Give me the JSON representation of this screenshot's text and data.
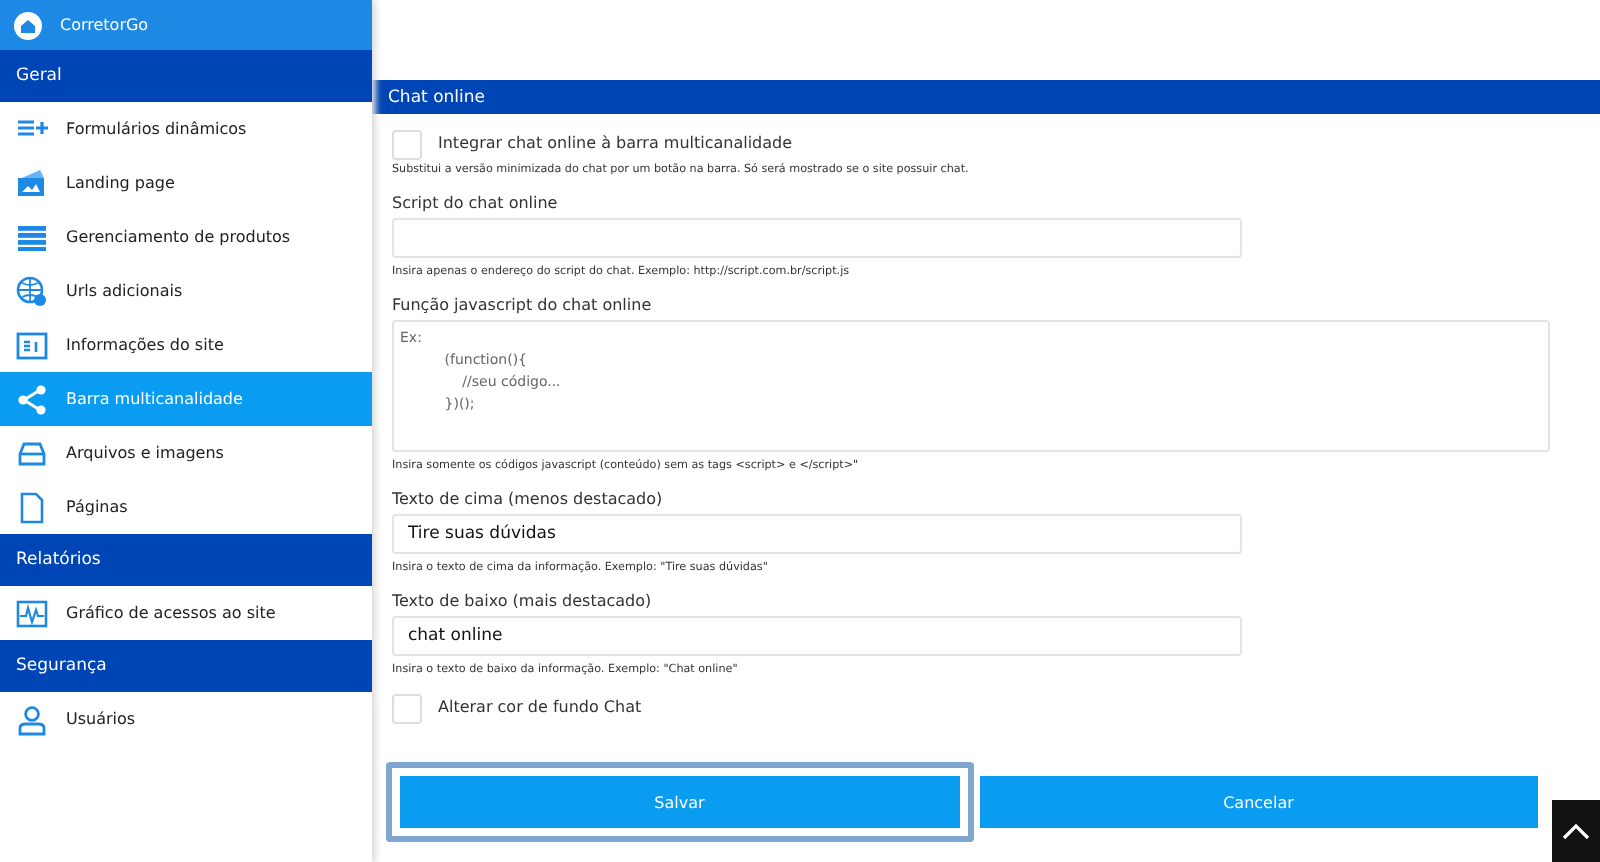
{
  "brand": {
    "title": "CorretorGo"
  },
  "sidebar": {
    "sections": [
      {
        "title": "Geral",
        "items": [
          {
            "label": "Formulários dinâmicos",
            "selected": false
          },
          {
            "label": "Landing page",
            "selected": false
          },
          {
            "label": "Gerenciamento de produtos",
            "selected": false
          },
          {
            "label": "Urls adicionais",
            "selected": false
          },
          {
            "label": "Informações do site",
            "selected": false
          },
          {
            "label": "Barra multicanalidade",
            "selected": true
          },
          {
            "label": "Arquivos e imagens",
            "selected": false
          },
          {
            "label": "Páginas",
            "selected": false
          }
        ]
      },
      {
        "title": "Relatórios",
        "items": [
          {
            "label": "Gráfico de acessos ao site",
            "selected": false
          }
        ]
      },
      {
        "title": "Segurança",
        "items": [
          {
            "label": "Usuários",
            "selected": false
          }
        ]
      }
    ]
  },
  "panel": {
    "title": "Chat online",
    "fields": [
      {
        "kind": "checkbox",
        "label": "Integrar chat online à barra multicanalidade",
        "checked": false,
        "help": "Substitui a versão minimizada do chat por um botão na barra. Só será mostrado se o site possuir chat."
      },
      {
        "kind": "text",
        "label": "Script do chat online",
        "help": "Insira apenas o endereço do script do chat. Exemplo: http://script.com.br/script.js"
      },
      {
        "kind": "textarea",
        "label": "Função javascript do chat online",
        "placeholder": "Ex:\n          (function(){\n              //seu código...\n          })();",
        "help": "Insira somente os códigos javascript (conteúdo) sem as tags <script> e </script>\""
      },
      {
        "kind": "text",
        "label": "Texto de cima (menos destacado)",
        "value": "Tire suas dúvidas",
        "help": "Insira o texto de cima da informação. Exemplo: \"Tire suas dúvidas\""
      },
      {
        "kind": "text",
        "label": "Texto de baixo (mais destacado)",
        "value": "chat online",
        "help": "Insira o texto de baixo da informação. Exemplo: \"Chat online\""
      },
      {
        "kind": "checkbox",
        "label": "Alterar cor de fundo Chat",
        "checked": false
      }
    ],
    "buttons": [
      {
        "label": "Salvar",
        "focused": true
      },
      {
        "label": "Cancelar",
        "focused": false
      }
    ]
  }
}
